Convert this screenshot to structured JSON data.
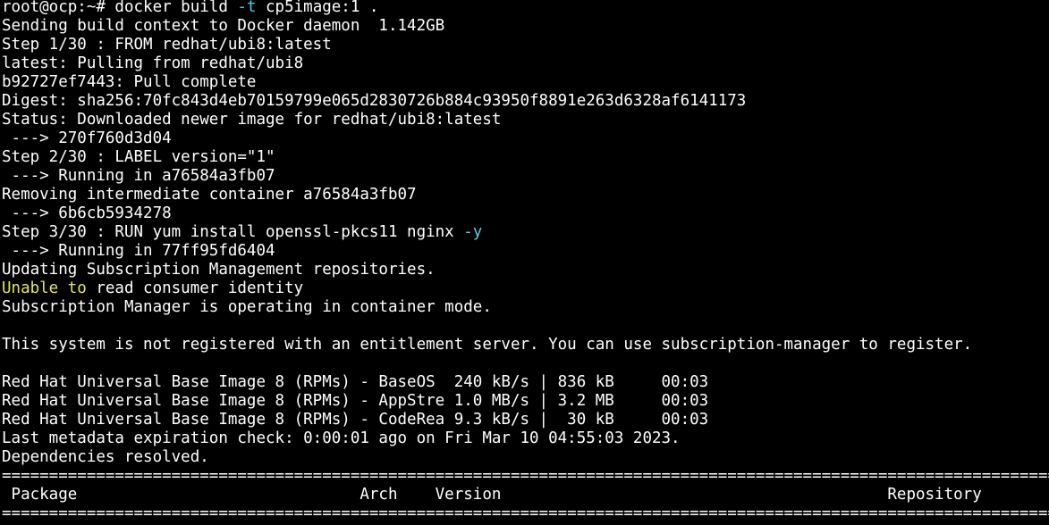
{
  "terminal": {
    "background_color": "#000000",
    "colors": {
      "default": "#ffffff",
      "option": "#5fc8e8",
      "warning": "#e6e65a"
    },
    "lines": [
      [
        {
          "text": "root@ocp:~# docker build "
        },
        {
          "text": "-t",
          "color": "option"
        },
        {
          "text": " cp5image:1 ."
        }
      ],
      [
        {
          "text": "Sending build context to Docker daemon  1.142GB"
        }
      ],
      [
        {
          "text": "Step 1/30 : FROM redhat/ubi8:latest"
        }
      ],
      [
        {
          "text": "latest: Pulling from redhat/ubi8"
        }
      ],
      [
        {
          "text": "b92727ef7443: Pull complete"
        }
      ],
      [
        {
          "text": "Digest: sha256:70fc843d4eb70159799e065d2830726b884c93950f8891e263d6328af6141173"
        }
      ],
      [
        {
          "text": "Status: Downloaded newer image for redhat/ubi8:latest"
        }
      ],
      [
        {
          "text": " ---> 270f760d3d04"
        }
      ],
      [
        {
          "text": "Step 2/30 : LABEL version=\"1\""
        }
      ],
      [
        {
          "text": " ---> Running in a76584a3fb07"
        }
      ],
      [
        {
          "text": "Removing intermediate container a76584a3fb07"
        }
      ],
      [
        {
          "text": " ---> 6b6cb5934278"
        }
      ],
      [
        {
          "text": "Step 3/30 : RUN yum install openssl-pkcs11 nginx "
        },
        {
          "text": "-y",
          "color": "option"
        }
      ],
      [
        {
          "text": " ---> Running in 77ff95fd6404"
        }
      ],
      [
        {
          "text": "Updating Subscription Management repositories."
        }
      ],
      [
        {
          "text": "Unable to",
          "color": "warning"
        },
        {
          "text": " read consumer identity"
        }
      ],
      [
        {
          "text": "Subscription Manager is operating in container mode."
        }
      ],
      [
        {
          "text": ""
        }
      ],
      [
        {
          "text": "This system is not registered with an entitlement server. You can use subscription-manager to register."
        }
      ],
      [
        {
          "text": ""
        }
      ],
      [
        {
          "text": "Red Hat Universal Base Image 8 (RPMs) - BaseOS  240 kB/s | 836 kB     00:03"
        }
      ],
      [
        {
          "text": "Red Hat Universal Base Image 8 (RPMs) - AppStre 1.0 MB/s | 3.2 MB     00:03"
        }
      ],
      [
        {
          "text": "Red Hat Universal Base Image 8 (RPMs) - CodeRea 9.3 kB/s |  30 kB     00:03"
        }
      ],
      [
        {
          "text": "Last metadata expiration check: 0:00:01 ago on Fri Mar 10 04:55:03 2023."
        }
      ],
      [
        {
          "text": "Dependencies resolved."
        }
      ],
      [
        {
          "text": "================================================================================================================================"
        }
      ],
      [
        {
          "text": " Package                              Arch    Version                                         Repository                  Size"
        }
      ],
      [
        {
          "text": "================================================================================================================================"
        }
      ]
    ]
  }
}
